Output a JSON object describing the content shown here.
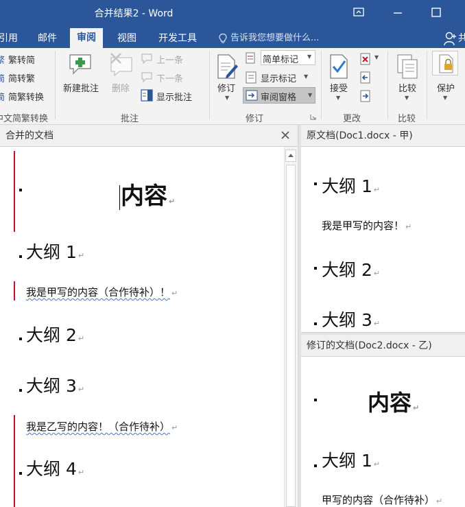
{
  "window": {
    "title": "合并结果2 - Word"
  },
  "tabs": [
    {
      "label": "引用",
      "active": false
    },
    {
      "label": "邮件",
      "active": false
    },
    {
      "label": "审阅",
      "active": true
    },
    {
      "label": "视图",
      "active": false
    },
    {
      "label": "开发工具",
      "active": false
    }
  ],
  "tell_me": "告诉我您想要做什么...",
  "share_glyph": "共",
  "ribbon": {
    "chinese_conversion": {
      "t2s": "繁转简",
      "s2t": "简转繁",
      "convert": "简繁转换",
      "group": "中文简繁转换",
      "icon_t2s": "繁",
      "icon_s2t": "简",
      "icon_conv": "简"
    },
    "comments": {
      "new": "新建批注",
      "delete": "删除",
      "prev": "上一条",
      "next": "下一条",
      "show": "显示批注",
      "group": "批注"
    },
    "tracking": {
      "track": "修订",
      "markup": "简单标记",
      "show_markup": "显示标记",
      "reviewing_pane": "审阅窗格",
      "group": "修订"
    },
    "changes": {
      "accept": "接受",
      "group": "更改"
    },
    "compare": {
      "compare": "比较",
      "group": "比较"
    },
    "protect": {
      "protect": "保护"
    }
  },
  "merged_pane": {
    "title": "合并的文档",
    "heading": "内容",
    "outline1": "大纲 1",
    "para_a": "我是甲写的内容（合作待补）！",
    "outline2": "大纲 2",
    "outline3": "大纲 3",
    "para_b": "我是乙写的内容！（合作待补）",
    "outline4": "大纲 4",
    "para_mark": "↵"
  },
  "original_pane": {
    "title": "原文档(Doc1.docx - 甲)",
    "outline1": "大纲 1",
    "para": "我是甲写的内容！",
    "outline2": "大纲 2",
    "outline3": "大纲 3"
  },
  "revised_pane": {
    "title": "修订的文档(Doc2.docx - 乙)",
    "heading": "内容",
    "outline1": "大纲 1",
    "para": "甲写的内容（合作待补）"
  },
  "colors": {
    "title_bar": "#2b579a",
    "ribbon": "#f3f3f3",
    "revision_bar": "#c8102e",
    "spell_underline": "#4a6ee0"
  }
}
